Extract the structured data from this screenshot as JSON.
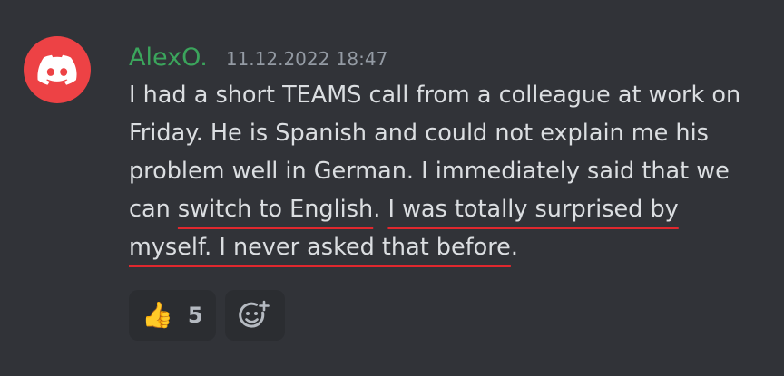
{
  "message": {
    "username": "AlexO.",
    "timestamp": "11.12.2022 18:47",
    "lines": [
      [
        "I had a short TEAMS call from a colleague at work on"
      ],
      [
        "Friday. He is Spanish and could not explain me his"
      ],
      [
        "problem well in German. I immediately said that we"
      ],
      [
        "can ",
        "switch to English",
        ". ",
        "I was totally surprised by"
      ],
      [
        "myself. I never asked that before",
        "."
      ]
    ]
  },
  "reactions": [
    {
      "emoji": "👍",
      "count": "5"
    }
  ],
  "colors": {
    "username": "#3ba55c",
    "avatar": "#ed4245",
    "underline": "#e0282e",
    "background": "#313338"
  },
  "icons": {
    "avatar": "discord-logo-icon",
    "add_reaction": "add-reaction-icon"
  }
}
